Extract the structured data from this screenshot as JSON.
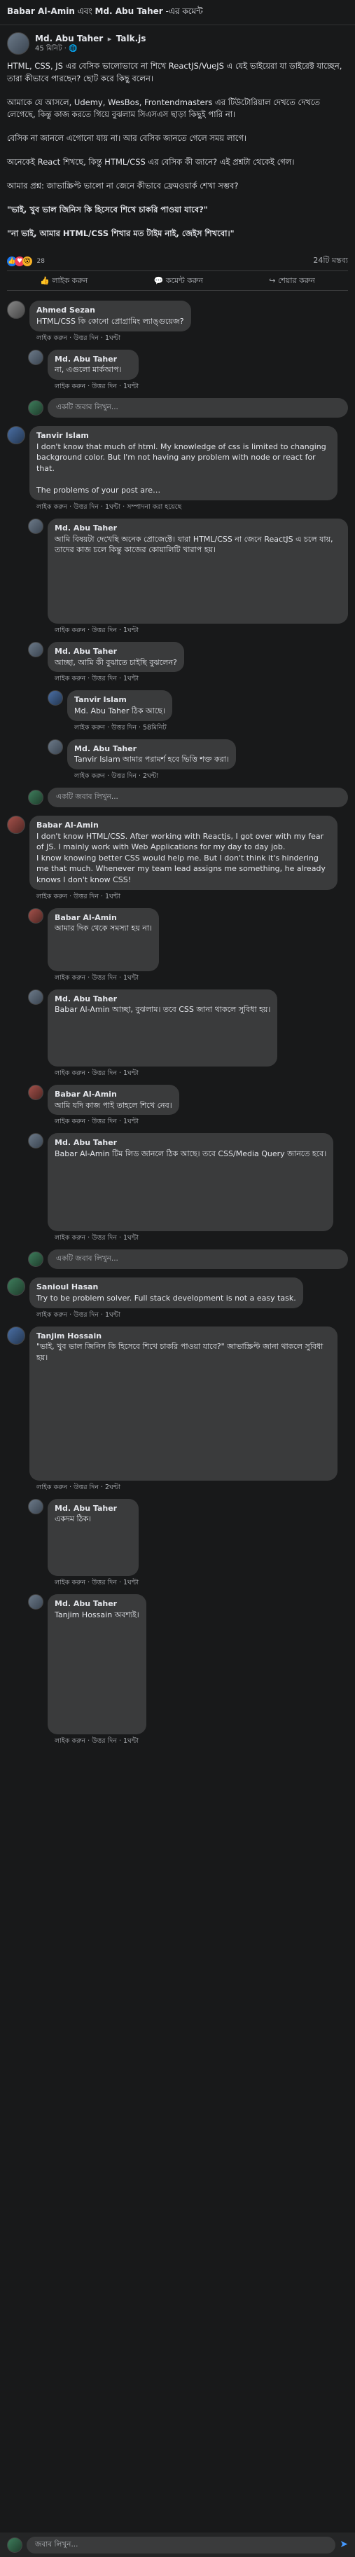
{
  "topbar": {
    "actor": "Babar Al-Amin",
    "mid": "এবং",
    "target": "Md. Abu Taher",
    "tail": "-এর কমেন্ট"
  },
  "post": {
    "author": "Md. Abu Taher",
    "group": "Talk.js",
    "time": "45 মিনিট · ",
    "paragraphs": [
      "HTML, CSS, JS এর বেসিক ভালোভাবে না শিখে ReactJS/VueJS এ যেই ভাইয়েরা যা ডাইরেক্ট যাচ্ছেন, তারা কীভাবে পারছেন? ছোট করে কিছু বলেন।",
      "আমাকে যে আসলে, Udemy, WesBos, Frontendmasters এর টিউটোরিয়াল দেখতে দেখতে লেগেছে, কিন্তু কাজ করতে গিয়ে বুঝলাম সিএসএস ছাড়া কিছুই পারি না।",
      "বেসিক না জানলে এগোনো যায় না। আর বেসিক জানতে গেলে সময় লাগে।",
      "অনেকেই React শিখছে, কিন্তু HTML/CSS এর বেসিক কী জানে? এই প্রশ্নটা থেকেই গেল।",
      "আমার প্রশ্ন: জাভাস্ক্রিপ্ট ভালো না জেনে কীভাবে ফ্রেমওয়ার্ক শেখা সম্ভব?"
    ],
    "quote1": "\"ভাই, খুব ভাল জিনিস কি হিসেবে শিখে চাকরি পাওয়া যাবে?\"",
    "quote2": "\"না ভাই, আমার HTML/CSS শিখার মত টাইম নাই, জেইস শিখবো।\"",
    "reaction_count": "28",
    "comment_count": "24টি মন্তব্য",
    "like_label": "লাইক করুন",
    "comment_label": "কমেন্ট করুন",
    "share_label": "শেয়ার করুন"
  },
  "comments": [
    {
      "author": "Ahmed Sezan",
      "text": "HTML/CSS কি কোনো প্রোগ্রামিং ল্যাঙ্গুয়েজ?",
      "actions": "লাইক করুন · উত্তর দিন · 1ঘন্টা"
    },
    {
      "author": "Md. Abu Taher",
      "text": "না, এগুলো মার্কআপ।",
      "actions": "লাইক করুন · উত্তর দিন · 1ঘন্টা"
    },
    {
      "author": "Tanvir Islam",
      "text": "I don't know that much of html. My knowledge of css is limited to changing background color. But I'm not having any problem with node or react for that.\n\nThe problems of your post are…",
      "actions": "লাইক করুন · উত্তর দিন · 1ঘন্টা · সম্পাদনা করা হয়েছে"
    },
    {
      "author": "Md. Abu Taher",
      "text": "আমি বিষয়টা দেখেছি অনেক প্রোজেক্টে। যারা HTML/CSS না জেনে ReactJS এ চলে যায়, তাদের কাজ চলে কিন্তু কাজের কোয়ালিটি খারাপ হয়।",
      "actions": "লাইক করুন · উত্তর দিন · 1ঘন্টা"
    },
    {
      "author": "Md. Abu Taher",
      "text": "আচ্ছা, আমি কী বুঝাতে চাইছি বুঝলেন?",
      "actions": "লাইক করুন · উত্তর দিন · 1ঘন্টা"
    },
    {
      "author": "Tanvir Islam",
      "text": "Md. Abu Taher ঠিক আছে।",
      "actions": "লাইক করুন · উত্তর দিন · 58মিনিট"
    },
    {
      "author": "Md. Abu Taher",
      "text": "Tanvir Islam আমার পরামর্শ হবে ভিত্তি শক্ত করা।",
      "actions": "লাইক করুন · উত্তর দিন · 2ঘন্টা"
    },
    {
      "author": "Babar Al-Amin",
      "text": "I don't know HTML/CSS. After working with Reactjs, I got over with my fear of JS. I mainly work with Web Applications for my day to day job.\nI know knowing better CSS would help me. But I don't think it's hindering me that much. Whenever my team lead assigns me something, he already knows I don't know CSS!",
      "actions": "লাইক করুন · উত্তর দিন · 1ঘন্টা"
    },
    {
      "author": "Babar Al-Amin",
      "text": "আমার দিক থেকে সমস্যা হয় না।",
      "actions": "লাইক করুন · উত্তর দিন · 1ঘন্টা"
    },
    {
      "author": "Md. Abu Taher",
      "text": "Babar Al-Amin আচ্ছা, বুঝলাম। তবে CSS জানা থাকলে সুবিধা হয়।",
      "actions": "লাইক করুন · উত্তর দিন · 1ঘন্টা"
    },
    {
      "author": "Babar Al-Amin",
      "text": "আমি যদি কাজ পাই তাহলে শিখে নেব।",
      "actions": "লাইক করুন · উত্তর দিন · 1ঘন্টা"
    },
    {
      "author": "Md. Abu Taher",
      "text": "Babar Al-Amin টিম লিড জানলে ঠিক আছে। তবে CSS/Media Query জানতে হবে।",
      "actions": "লাইক করুন · উত্তর দিন · 1ঘন্টা"
    },
    {
      "author": "Sanioul Hasan",
      "text": "Try to be problem solver. Full stack development is not a easy task.",
      "actions": "লাইক করুন · উত্তর দিন · 1ঘন্টা"
    },
    {
      "author": "Tanjim Hossain",
      "text": "\"ভাই, খুব ভাল জিনিস কি হিসেবে শিখে চাকরি পাওয়া যাবে?\" জাভাস্ক্রিপ্ট জানা থাকলে সুবিধা হয়।",
      "actions": "লাইক করুন · উত্তর দিন · 2ঘন্টা"
    },
    {
      "author": "Md. Abu Taher",
      "text": "একদম ঠিক।",
      "actions": "লাইক করুন · উত্তর দিন · 1ঘন্টা"
    },
    {
      "author": "Md. Abu Taher",
      "text": "Tanjim Hossain অবশ্যই।",
      "actions": "লাইক করুন · উত্তর দিন · 1ঘন্টা"
    }
  ],
  "reply_placeholder": "একটি জবাব লিখুন...",
  "bottom_placeholder": "জবাব লিখুন..."
}
